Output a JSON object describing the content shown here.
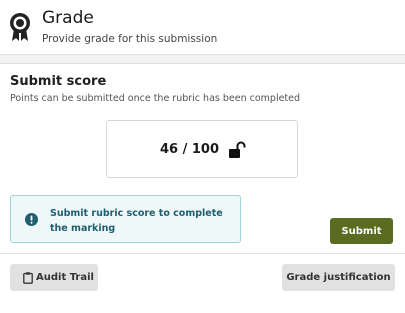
{
  "header": {
    "title": "Grade",
    "subtitle": "Provide grade for this submission",
    "icon": "award-icon"
  },
  "score_section": {
    "title": "Submit score",
    "subtitle": "Points can be submitted once the rubric has been completed",
    "score": "46 / 100",
    "lock_icon": "unlock-icon"
  },
  "notice": {
    "icon": "info-icon",
    "text": "Submit rubric score to complete the marking"
  },
  "actions": {
    "submit_label": "Submit",
    "audit_trail_label": "Audit Trail",
    "grade_justification_label": "Grade justification"
  },
  "colors": {
    "submit_bg": "#5b6b1f",
    "notice_bg": "#eef8f9",
    "notice_border": "#9fd3d9",
    "notice_text": "#1f5e6e"
  }
}
